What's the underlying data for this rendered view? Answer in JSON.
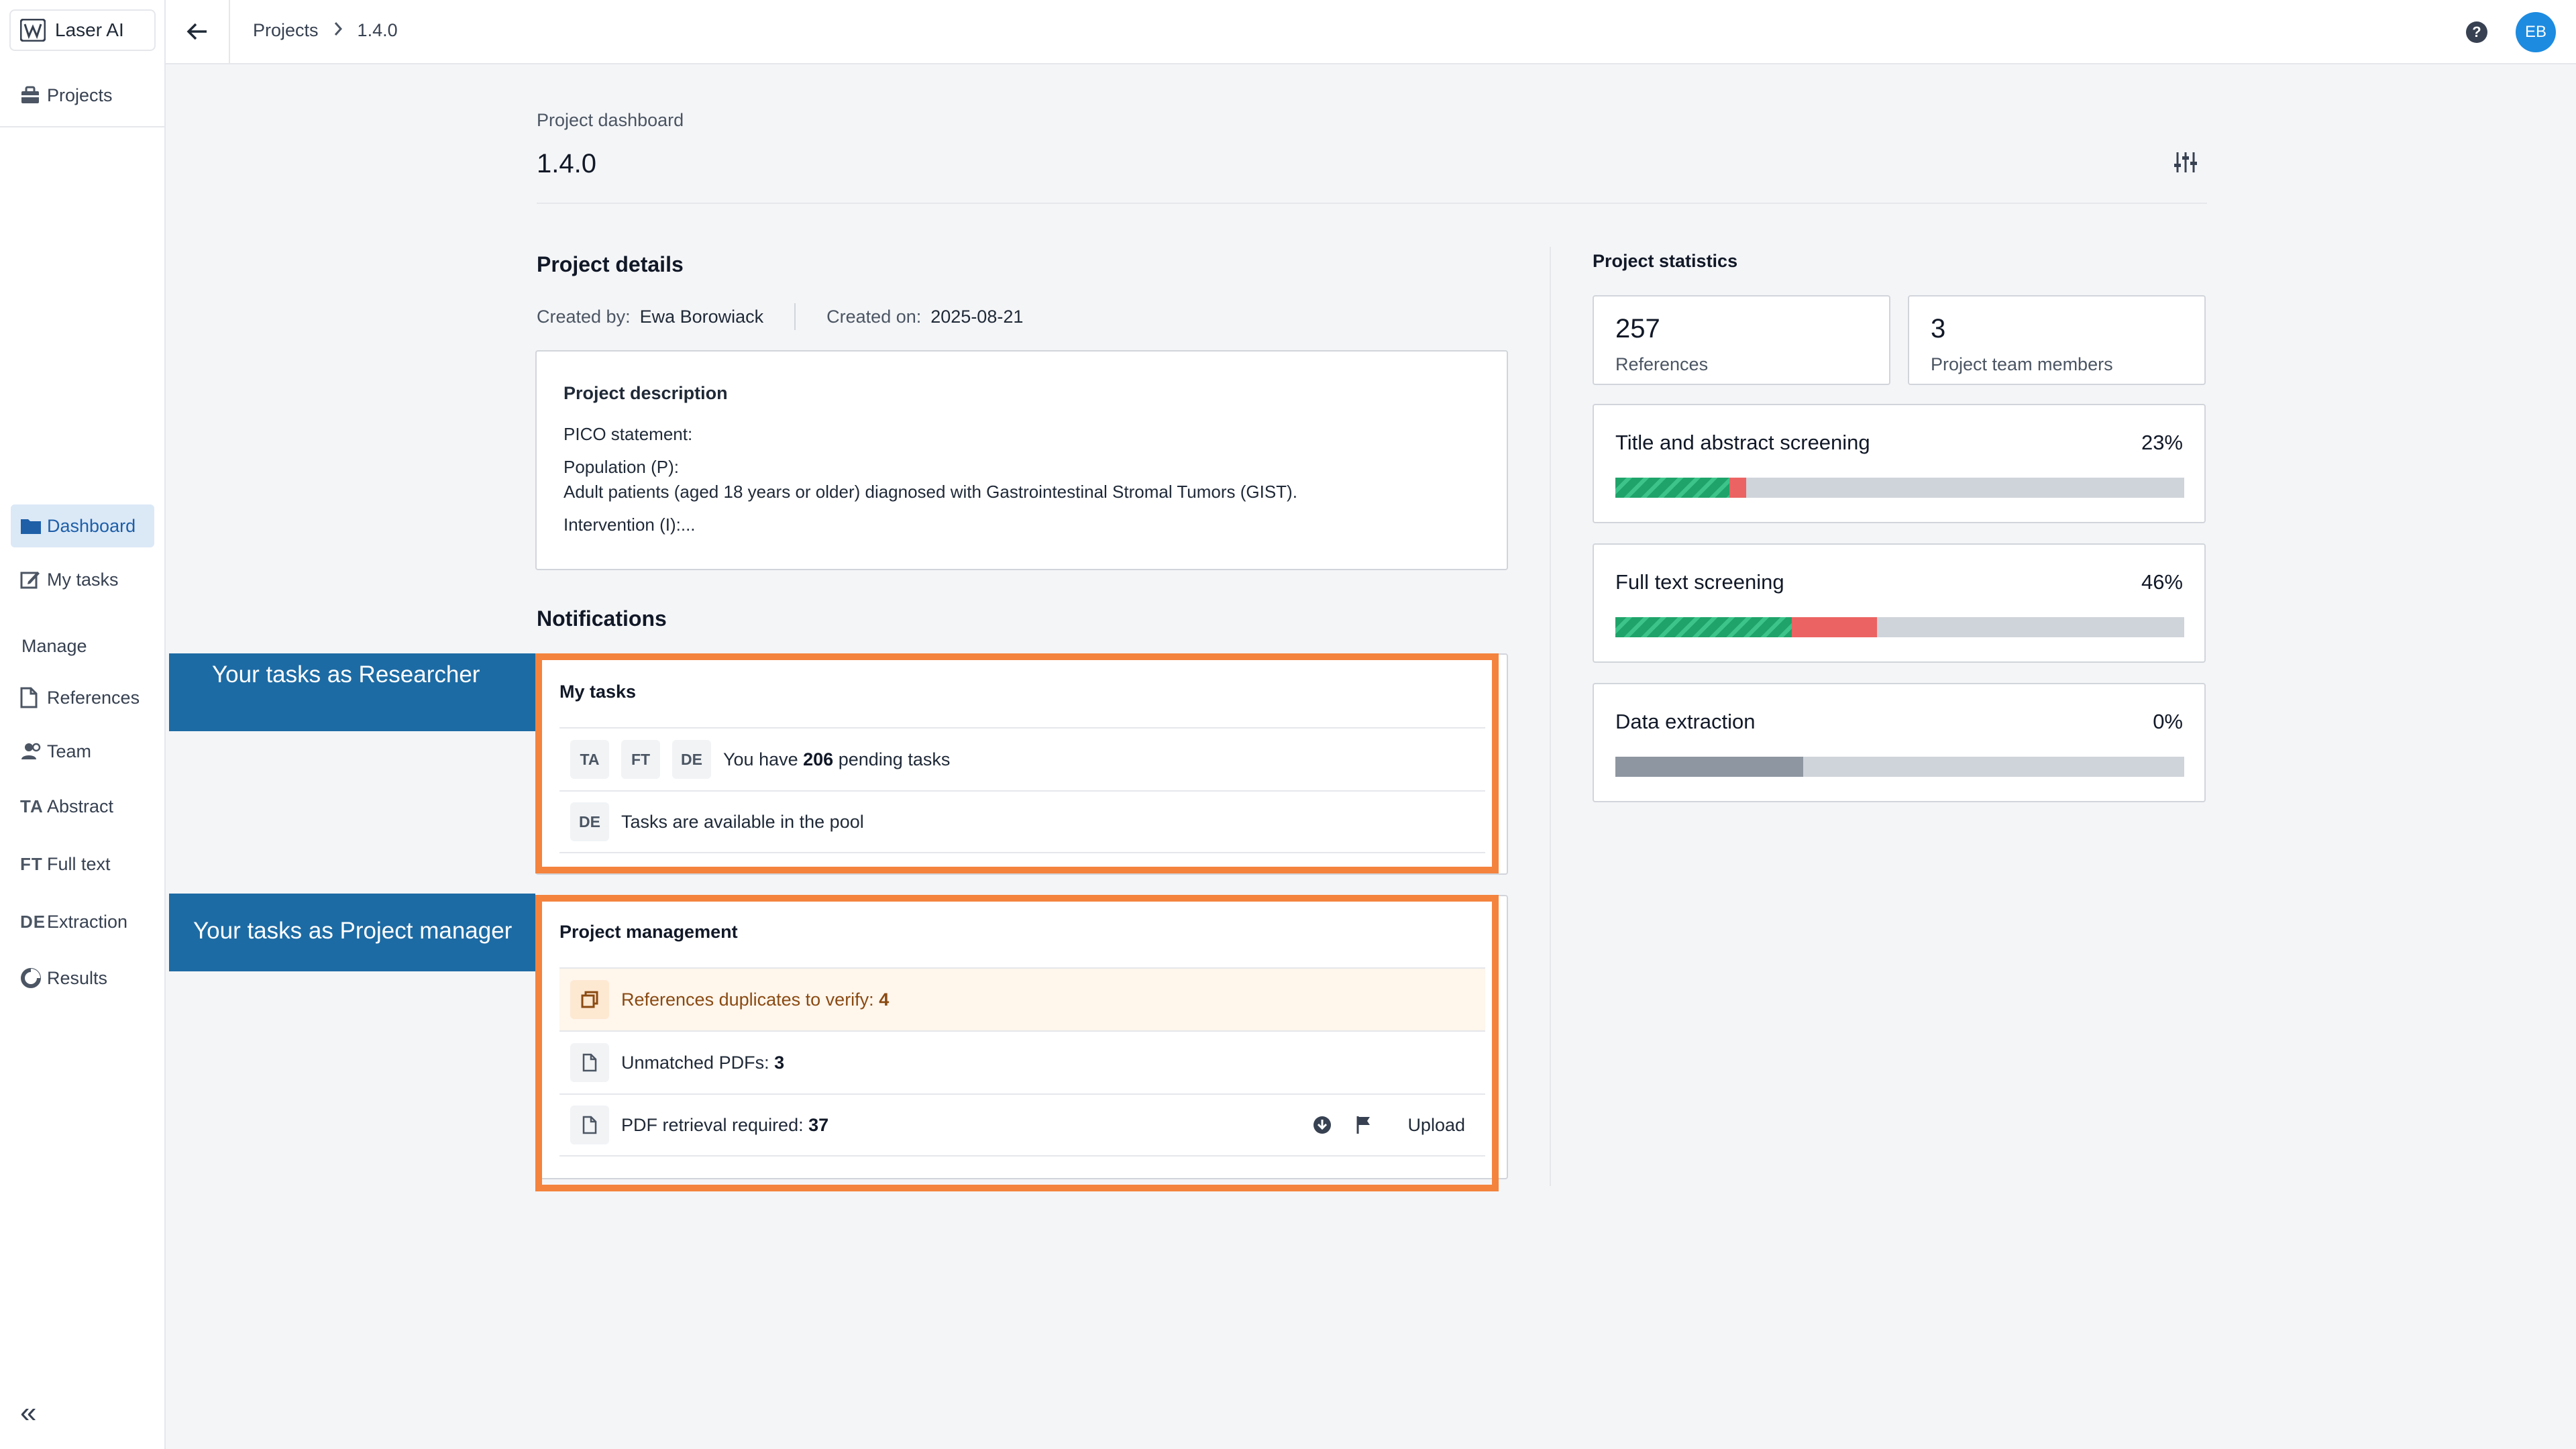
{
  "app": {
    "name": "Laser AI"
  },
  "sidebar": {
    "projects_label": "Projects",
    "nav": [
      {
        "label": "Dashboard",
        "icon": "folder-icon",
        "active": true
      },
      {
        "label": "My tasks",
        "icon": "edit-icon"
      }
    ],
    "manage_header": "Manage",
    "manage": [
      {
        "label": "References",
        "icon": "document-icon"
      },
      {
        "label": "Team",
        "icon": "team-icon"
      },
      {
        "label": "Abstract",
        "icon": "TA"
      },
      {
        "label": "Full text",
        "icon": "FT"
      },
      {
        "label": "Extraction",
        "icon": "DE"
      },
      {
        "label": "Results",
        "icon": "results-icon"
      }
    ],
    "collapse_icon": "«"
  },
  "topbar": {
    "breadcrumb": [
      "Projects",
      "1.4.0"
    ],
    "help_icon": "?",
    "avatar_initials": "EB"
  },
  "dashboard": {
    "label": "Project dashboard",
    "title": "1.4.0"
  },
  "details": {
    "title": "Project details",
    "created_by_label": "Created by:",
    "created_by": "Ewa Borowiack",
    "created_on_label": "Created on:",
    "created_on": "2025-08-21",
    "description_title": "Project description",
    "description_lines": [
      "PICO statement:",
      "Population (P):",
      "Adult patients (aged 18 years or older) diagnosed with Gastrointestinal Stromal Tumors (GIST).",
      "Intervention (I):..."
    ]
  },
  "notifications": {
    "title": "Notifications",
    "callout_researcher": "Your tasks as Researcher",
    "callout_manager": "Your tasks as Project manager",
    "my_tasks": {
      "title": "My tasks",
      "pending_prefix": "You have",
      "pending_count": "206",
      "pending_suffix": "pending tasks",
      "pending_chips": [
        "TA",
        "FT",
        "DE"
      ],
      "pool_chip": "DE",
      "pool_text": "Tasks are available in the pool"
    },
    "management": {
      "title": "Project management",
      "duplicates_label": "References duplicates to verify:",
      "duplicates_count": "4",
      "unmatched_label": "Unmatched PDFs:",
      "unmatched_count": "3",
      "retrieval_label": "PDF retrieval required:",
      "retrieval_count": "37",
      "upload_label": "Upload"
    }
  },
  "statistics": {
    "title": "Project statistics",
    "references_count": "257",
    "references_label": "References",
    "team_count": "3",
    "team_label": "Project team members",
    "stages": [
      {
        "name": "Title and abstract screening",
        "percent_label": "23%",
        "included": 0.2,
        "excluded": 0.03,
        "neutral": 0
      },
      {
        "name": "Full text screening",
        "percent_label": "46%",
        "included": 0.31,
        "excluded": 0.15,
        "neutral": 0
      },
      {
        "name": "Data extraction",
        "percent_label": "0%",
        "included": 0,
        "excluded": 0,
        "neutral": 0.33
      }
    ]
  },
  "colors": {
    "accent": "#1e5fa8",
    "callout": "#1d6ba4",
    "highlight_frame": "#f4833d",
    "included": "#1fa36a",
    "excluded": "#ec6363",
    "track": "#cfd4da"
  }
}
